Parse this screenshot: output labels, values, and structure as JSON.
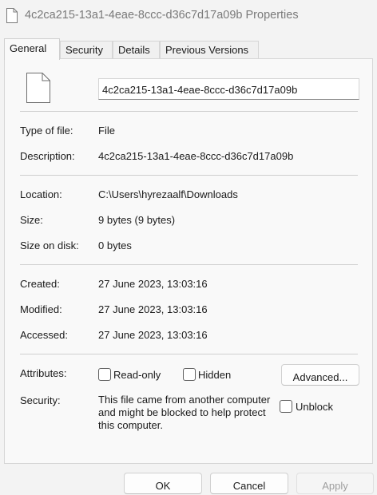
{
  "window": {
    "title": "4c2ca215-13a1-4eae-8ccc-d36c7d17a09b Properties"
  },
  "tabs": [
    {
      "label": "General",
      "active": true
    },
    {
      "label": "Security",
      "active": false
    },
    {
      "label": "Details",
      "active": false
    },
    {
      "label": "Previous Versions",
      "active": false
    }
  ],
  "general": {
    "file_name": "4c2ca215-13a1-4eae-8ccc-d36c7d17a09b",
    "type_label": "Type of file:",
    "type_value": "File",
    "description_label": "Description:",
    "description_value": "4c2ca215-13a1-4eae-8ccc-d36c7d17a09b",
    "location_label": "Location:",
    "location_value": "C:\\Users\\hyrezaalf\\Downloads",
    "size_label": "Size:",
    "size_value": "9 bytes (9 bytes)",
    "size_on_disk_label": "Size on disk:",
    "size_on_disk_value": "0 bytes",
    "created_label": "Created:",
    "created_value": "27 June 2023, 13:03:16",
    "modified_label": "Modified:",
    "modified_value": "27 June 2023, 13:03:16",
    "accessed_label": "Accessed:",
    "accessed_value": "27 June 2023, 13:03:16",
    "attributes_label": "Attributes:",
    "readonly_label": "Read-only",
    "readonly_checked": false,
    "hidden_label": "Hidden",
    "hidden_checked": false,
    "advanced_label": "Advanced...",
    "security_label": "Security:",
    "security_text": "This file came from another computer and might be blocked to help protect this computer.",
    "unblock_label": "Unblock",
    "unblock_checked": false
  },
  "buttons": {
    "ok": "OK",
    "cancel": "Cancel",
    "apply": "Apply"
  },
  "icons": {
    "title": "file-icon",
    "file": "file-icon"
  },
  "colors": {
    "window_bg": "#f3f3f3",
    "panel_bg": "#f9f9f9",
    "border": "#d6d6d6",
    "disabled_text": "#9e9e9e"
  }
}
